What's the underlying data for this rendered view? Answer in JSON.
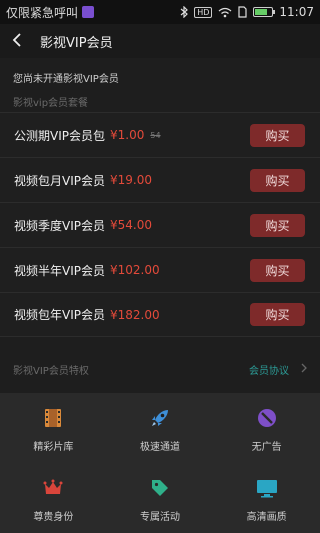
{
  "status_bar": {
    "carrier_text": "仅限紧急呼叫",
    "time": "11:07",
    "network_badge": "HD",
    "battery_level": 0.75,
    "icons": [
      "app-icon",
      "bluetooth-icon",
      "hd-badge-icon",
      "wifi-icon",
      "sim-icon",
      "battery-icon"
    ]
  },
  "nav": {
    "title": "影视VIP会员",
    "back_icon": "chevron-left-icon"
  },
  "notice": "您尚未开通影视VIP会员",
  "packages_section_label": "影视vip会员套餐",
  "packages": [
    {
      "name": "公测期VIP会员包",
      "price": "¥1.00",
      "original_price": "54",
      "buy_label": "购买"
    },
    {
      "name": "视频包月VIP会员",
      "price": "¥19.00",
      "original_price": "",
      "buy_label": "购买"
    },
    {
      "name": "视频季度VIP会员",
      "price": "¥54.00",
      "original_price": "",
      "buy_label": "购买"
    },
    {
      "name": "视频半年VIP会员",
      "price": "¥102.00",
      "original_price": "",
      "buy_label": "购买"
    },
    {
      "name": "视频包年VIP会员",
      "price": "¥182.00",
      "original_price": "",
      "buy_label": "购买"
    }
  ],
  "privileges": {
    "title": "影视VIP会员特权",
    "agreement_link": "会员协议",
    "items": [
      {
        "label": "精彩片库",
        "icon": "film-icon",
        "color": "#d9893a"
      },
      {
        "label": "极速通道",
        "icon": "rocket-icon",
        "color": "#3e8fd8"
      },
      {
        "label": "无广告",
        "icon": "no-ads-icon",
        "color": "#7e4fc8"
      },
      {
        "label": "尊贵身份",
        "icon": "crown-icon",
        "color": "#d9453b"
      },
      {
        "label": "专属活动",
        "icon": "tag-icon",
        "color": "#2fb08a"
      },
      {
        "label": "高清画质",
        "icon": "hd-screen-icon",
        "color": "#2aa6c4"
      }
    ]
  },
  "colors": {
    "price": "#e34a3a",
    "buy_button": "#7e2a2a",
    "link": "#2c9b96"
  }
}
